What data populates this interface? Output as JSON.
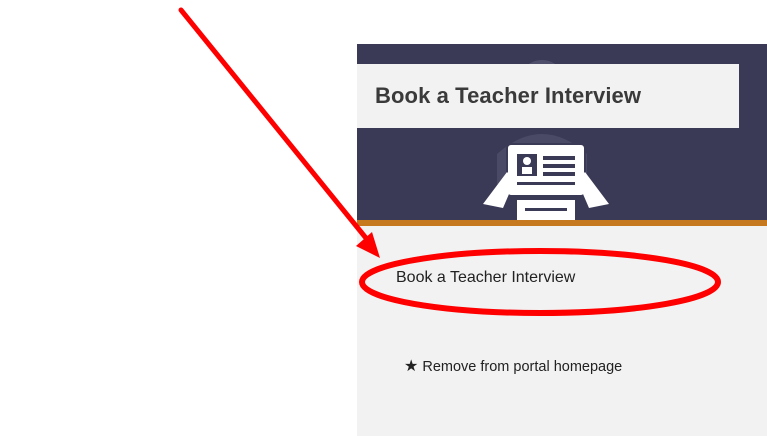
{
  "card": {
    "title": "Book a Teacher Interview",
    "link_label": "Book a Teacher Interview",
    "remove_label": "Remove from portal homepage",
    "star_glyph": "★",
    "banner_color": "#3b3a56",
    "accent_color": "#c7791f",
    "banner_icon": "teacher-with-resume-illustration"
  },
  "annotation": {
    "arrow_color": "#ff0000",
    "ellipse_color": "#ff0000"
  }
}
